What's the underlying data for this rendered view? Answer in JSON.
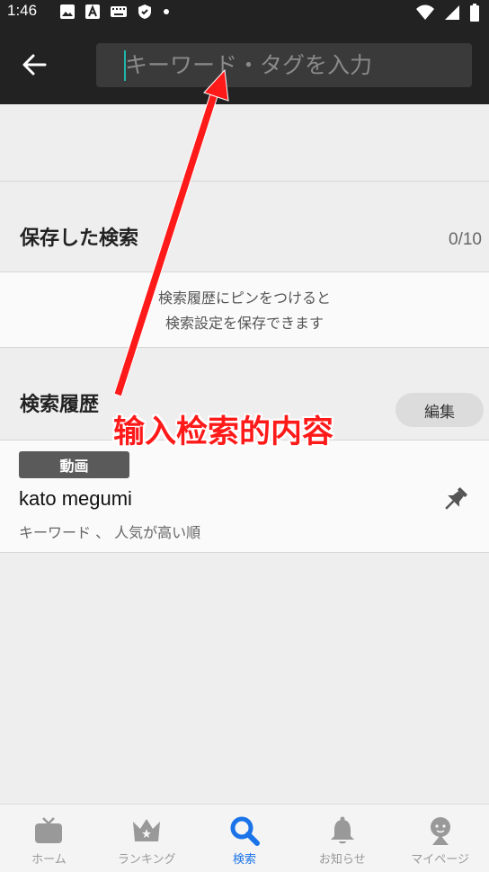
{
  "status_bar": {
    "time": "1:46"
  },
  "app_bar": {
    "search_placeholder": "キーワード・タグを入力"
  },
  "saved_searches": {
    "title": "保存した検索",
    "count": "0/10",
    "empty_line1": "検索履歴にピンをつけると",
    "empty_line2": "検索設定を保存できます"
  },
  "history": {
    "title": "検索履歴",
    "edit_label": "編集",
    "items": [
      {
        "tag": "動画",
        "title": "kato megumi",
        "subtitle": "キーワード 、 人気が高い順"
      }
    ]
  },
  "annotation": {
    "text": "输入检索的内容",
    "color": "#ff1a1a"
  },
  "bottom_nav": {
    "items": [
      {
        "label": "ホーム",
        "icon": "tv-icon"
      },
      {
        "label": "ランキング",
        "icon": "crown-icon"
      },
      {
        "label": "検索",
        "icon": "search-icon",
        "active": true
      },
      {
        "label": "お知らせ",
        "icon": "bell-icon"
      },
      {
        "label": "マイページ",
        "icon": "person-icon"
      }
    ]
  },
  "colors": {
    "app_bar": "#222222",
    "active": "#1a73e8",
    "caret": "#1fb5a8"
  }
}
